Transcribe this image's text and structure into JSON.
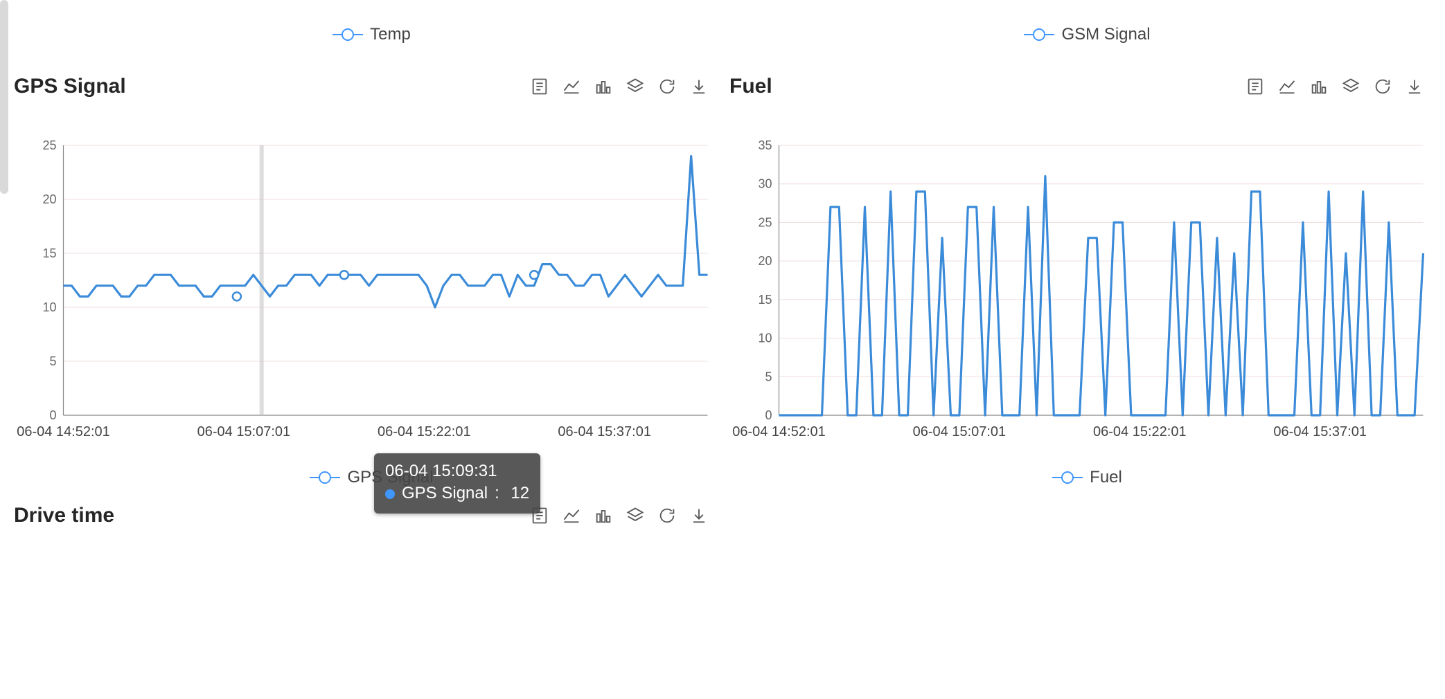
{
  "legends": {
    "top_left": "Temp",
    "top_right": "GSM Signal",
    "bottom_left": "GPS Signal",
    "bottom_right": "Fuel"
  },
  "panels": {
    "gps": {
      "title": "GPS Signal"
    },
    "fuel": {
      "title": "Fuel"
    },
    "drive": {
      "title": "Drive time"
    }
  },
  "toolbox": {
    "data_view": "Data View",
    "line": "Switch to line",
    "bar": "Switch to bar",
    "stack": "Stack",
    "refresh": "Restore",
    "download": "Save as image"
  },
  "tooltip": {
    "time": "06-04 15:09:31",
    "series": "GPS Signal",
    "value": "12"
  },
  "colors": {
    "series": "#3b8bd9"
  },
  "chart_data": [
    {
      "id": "gps_signal",
      "type": "line",
      "title": "GPS Signal",
      "xlabel": "",
      "ylabel": "",
      "ylim": [
        0,
        25
      ],
      "y_ticks": [
        0,
        5,
        10,
        15,
        20,
        25
      ],
      "x_tick_labels": [
        "06-04 14:52:01",
        "06-04 15:07:01",
        "06-04 15:22:01",
        "06-04 15:37:01"
      ],
      "series": [
        {
          "name": "GPS Signal",
          "values": [
            12,
            12,
            11,
            11,
            12,
            12,
            12,
            11,
            11,
            12,
            12,
            13,
            13,
            13,
            12,
            12,
            12,
            11,
            11,
            12,
            12,
            12,
            12,
            13,
            12,
            11,
            12,
            12,
            13,
            13,
            13,
            12,
            13,
            13,
            13,
            13,
            13,
            12,
            13,
            13,
            13,
            13,
            13,
            13,
            12,
            10,
            12,
            13,
            13,
            12,
            12,
            12,
            13,
            13,
            11,
            13,
            12,
            12,
            14,
            14,
            13,
            13,
            12,
            12,
            13,
            13,
            11,
            12,
            13,
            12,
            11,
            12,
            13,
            12,
            12,
            12,
            24,
            13,
            13
          ]
        }
      ],
      "markers": [
        {
          "index": 21,
          "value": 11
        },
        {
          "index": 34,
          "value": 13
        },
        {
          "index": 57,
          "value": 13
        }
      ],
      "cursor": {
        "index": 24,
        "time": "06-04 15:09:31",
        "value": 12
      }
    },
    {
      "id": "fuel",
      "type": "line",
      "title": "Fuel",
      "xlabel": "",
      "ylabel": "",
      "ylim": [
        0,
        35
      ],
      "y_ticks": [
        0,
        5,
        10,
        15,
        20,
        25,
        30,
        35
      ],
      "x_tick_labels": [
        "06-04 14:52:01",
        "06-04 15:07:01",
        "06-04 15:22:01",
        "06-04 15:37:01"
      ],
      "series": [
        {
          "name": "Fuel",
          "values": [
            0,
            0,
            0,
            0,
            0,
            0,
            27,
            27,
            0,
            0,
            27,
            0,
            0,
            29,
            0,
            0,
            29,
            29,
            0,
            23,
            0,
            0,
            27,
            27,
            0,
            27,
            0,
            0,
            0,
            27,
            0,
            31,
            0,
            0,
            0,
            0,
            23,
            23,
            0,
            25,
            25,
            0,
            0,
            0,
            0,
            0,
            25,
            0,
            25,
            25,
            0,
            23,
            0,
            21,
            0,
            29,
            29,
            0,
            0,
            0,
            0,
            25,
            0,
            0,
            29,
            0,
            21,
            0,
            29,
            0,
            0,
            25,
            0,
            0,
            0,
            21
          ]
        }
      ]
    }
  ]
}
